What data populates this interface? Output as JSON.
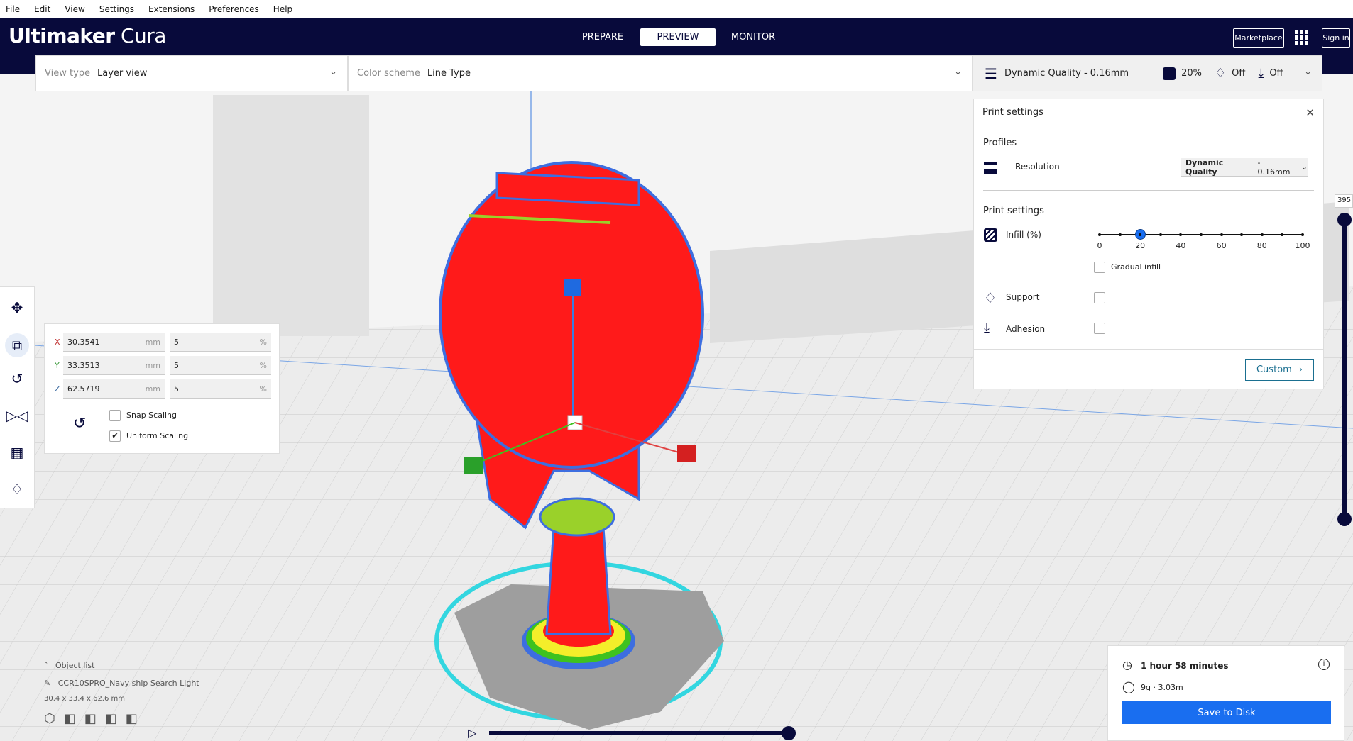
{
  "menu": [
    "File",
    "Edit",
    "View",
    "Settings",
    "Extensions",
    "Preferences",
    "Help"
  ],
  "header": {
    "logo_bold": "Ultimaker",
    "logo_light": "Cura",
    "tabs": [
      {
        "label": "PREPARE"
      },
      {
        "label": "PREVIEW",
        "active": true
      },
      {
        "label": "MONITOR"
      }
    ],
    "marketplace": "Marketplace",
    "signin": "Sign in"
  },
  "toolbar": {
    "view_type_label": "View type",
    "view_type_value": "Layer view",
    "color_scheme_label": "Color scheme",
    "color_scheme_value": "Line Type",
    "profile": "Dynamic Quality - 0.16mm",
    "infill": "20%",
    "support": "Off",
    "adhesion": "Off"
  },
  "print_settings": {
    "title": "Print settings",
    "profiles_label": "Profiles",
    "resolution_label": "Resolution",
    "resolution_bold": "Dynamic Quality",
    "resolution_rest": " - 0.16mm",
    "section": "Print settings",
    "infill_label": "Infill (%)",
    "infill_value": 20,
    "infill_ticks": [
      "0",
      "20",
      "40",
      "60",
      "80",
      "100"
    ],
    "gradual_label": "Gradual infill",
    "gradual": false,
    "support_label": "Support",
    "support": false,
    "adhesion_label": "Adhesion",
    "adhesion": false,
    "custom_label": "Custom"
  },
  "scale": {
    "x_label": "X",
    "x_mm": "30.3541",
    "x_pct": "5",
    "y_label": "Y",
    "y_mm": "33.3513",
    "y_pct": "5",
    "z_label": "Z",
    "z_mm": "62.5719",
    "z_pct": "5",
    "unit_mm": "mm",
    "unit_pct": "%",
    "snap_label": "Snap Scaling",
    "snap": false,
    "uniform_label": "Uniform Scaling",
    "uniform": true
  },
  "objects": {
    "header": "Object list",
    "file": "CCR10SPRO_Navy ship Search Light",
    "dims": "30.4 x 33.4 x 62.6 mm"
  },
  "layer": {
    "max": "395"
  },
  "estimate": {
    "time": "1 hour 58 minutes",
    "material": "9g · 3.03m",
    "save": "Save to Disk"
  },
  "colors": {
    "header": "#080a3b",
    "accent": "#196ef0",
    "model": "#ff1a1a"
  }
}
